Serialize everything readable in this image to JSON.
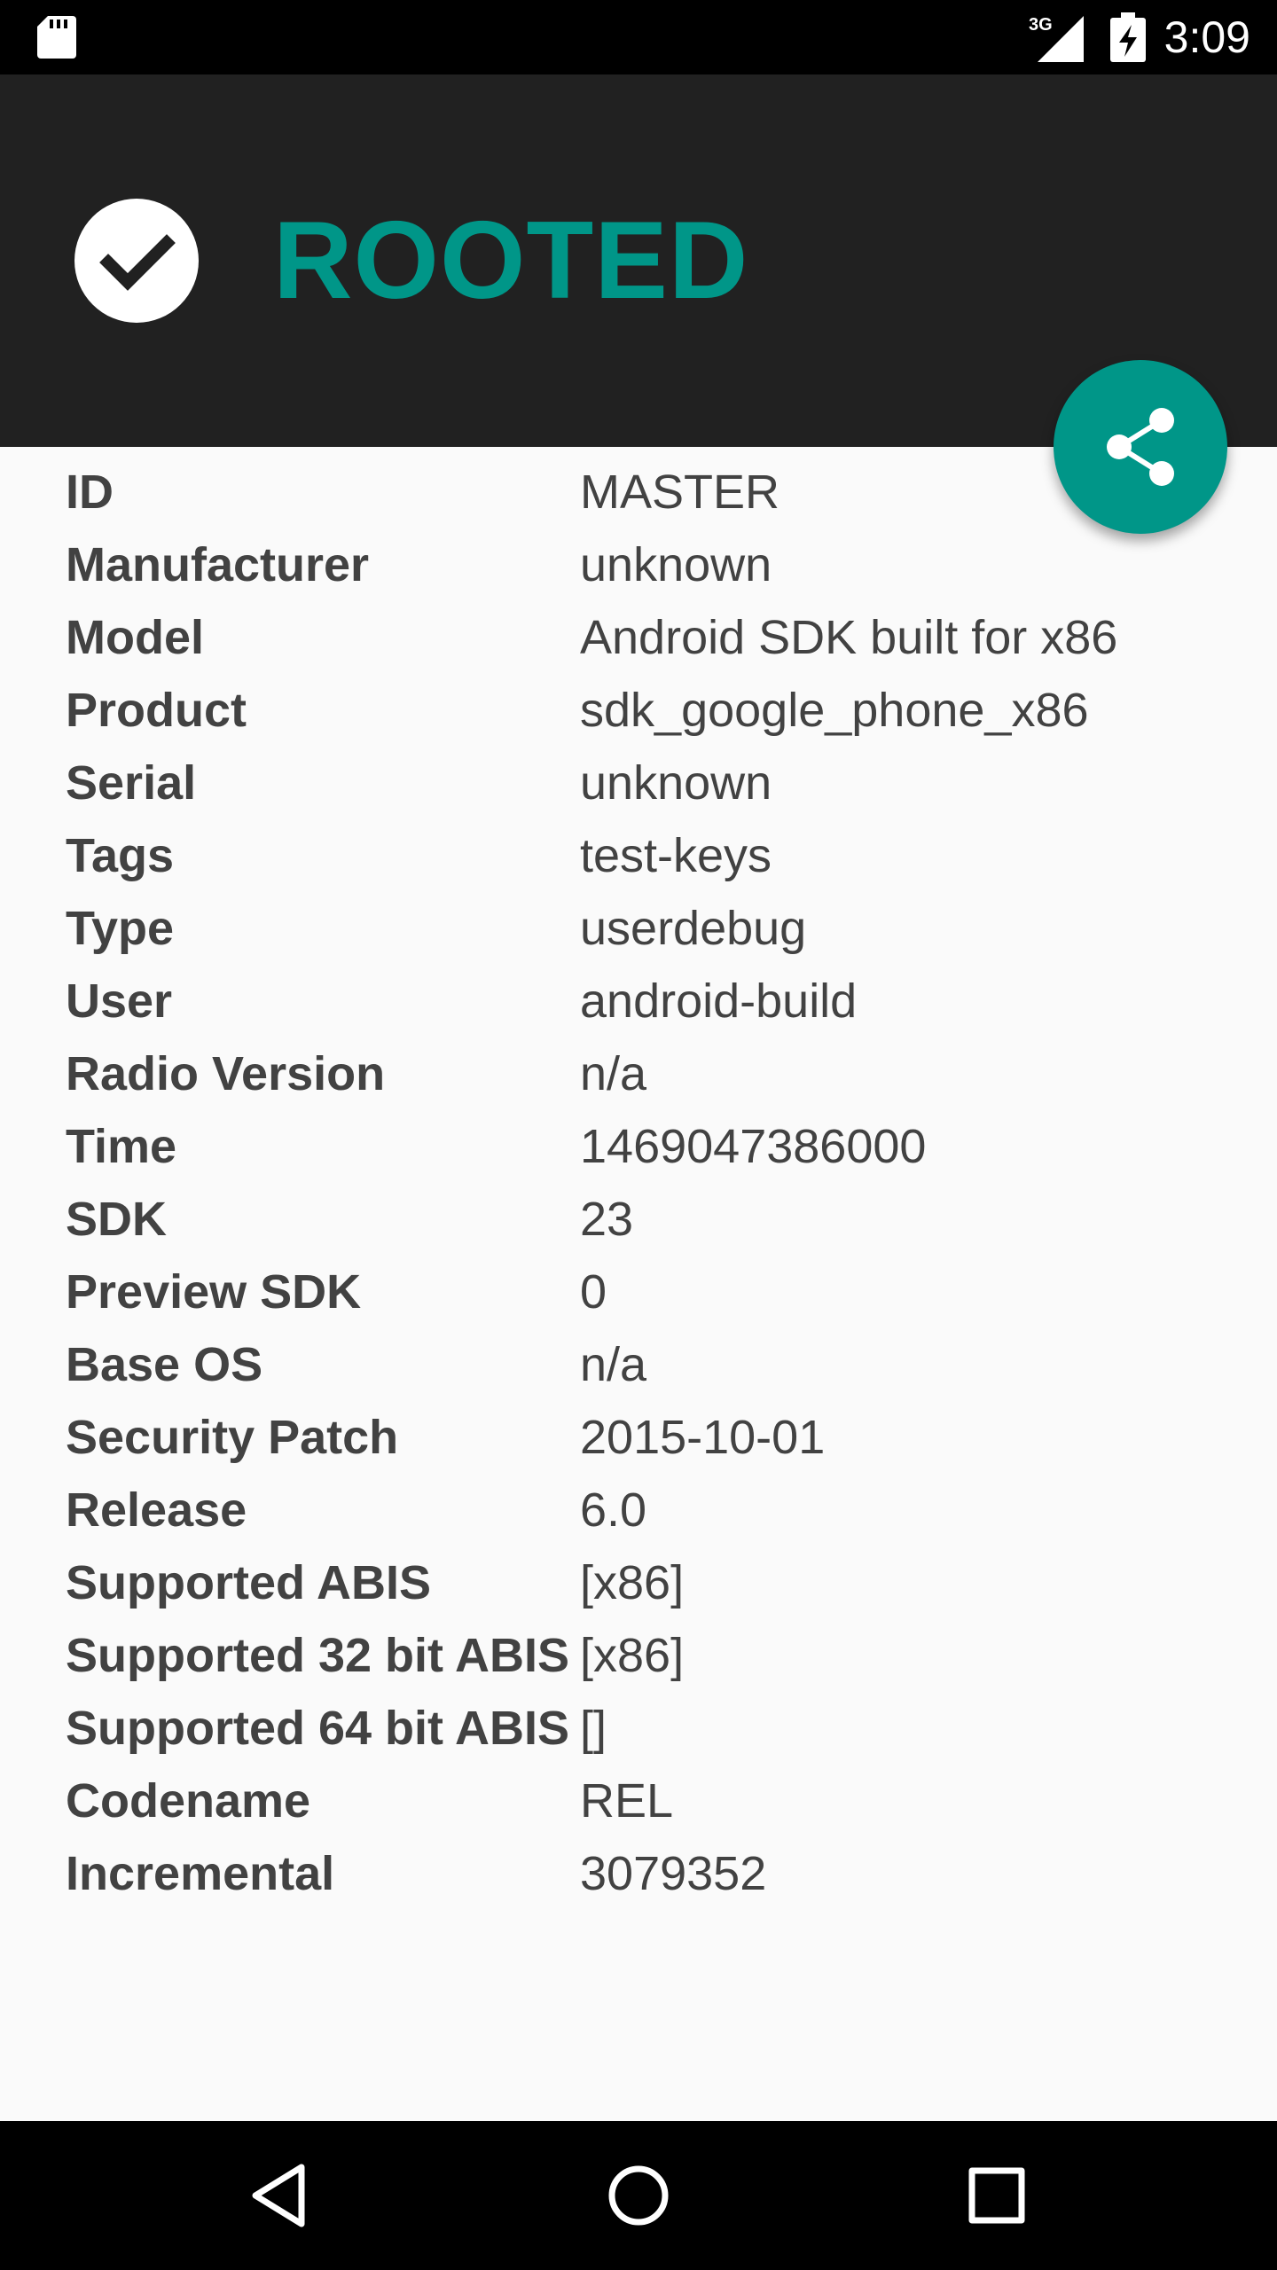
{
  "status_bar": {
    "time": "3:09",
    "network": "3G",
    "icons": [
      "sd-card-icon",
      "signal-icon",
      "battery-charging-icon"
    ]
  },
  "header": {
    "status": "ROOTED",
    "badge_icon": "check-icon",
    "accent_color": "#009688",
    "background_color": "#212121"
  },
  "fab": {
    "icon": "share-icon"
  },
  "info_rows": [
    {
      "label": "ID",
      "value": "MASTER"
    },
    {
      "label": "Manufacturer",
      "value": "unknown"
    },
    {
      "label": "Model",
      "value": "Android SDK built for x86"
    },
    {
      "label": "Product",
      "value": "sdk_google_phone_x86"
    },
    {
      "label": "Serial",
      "value": "unknown"
    },
    {
      "label": "Tags",
      "value": "test-keys"
    },
    {
      "label": "Type",
      "value": "userdebug"
    },
    {
      "label": "User",
      "value": "android-build"
    },
    {
      "label": "Radio Version",
      "value": "n/a"
    },
    {
      "label": "Time",
      "value": "1469047386000"
    },
    {
      "label": "SDK",
      "value": "23"
    },
    {
      "label": "Preview SDK",
      "value": "0"
    },
    {
      "label": "Base OS",
      "value": "n/a"
    },
    {
      "label": "Security Patch",
      "value": "2015-10-01"
    },
    {
      "label": "Release",
      "value": "6.0"
    },
    {
      "label": "Supported ABIS",
      "value": "[x86]"
    },
    {
      "label": "Supported 32 bit ABIS",
      "value": "[x86]"
    },
    {
      "label": "Supported 64 bit ABIS",
      "value": "[]"
    },
    {
      "label": "Codename",
      "value": "REL"
    },
    {
      "label": "Incremental",
      "value": "3079352"
    }
  ],
  "nav_bar": {
    "icons": [
      "back-icon",
      "home-icon",
      "recents-icon"
    ]
  }
}
